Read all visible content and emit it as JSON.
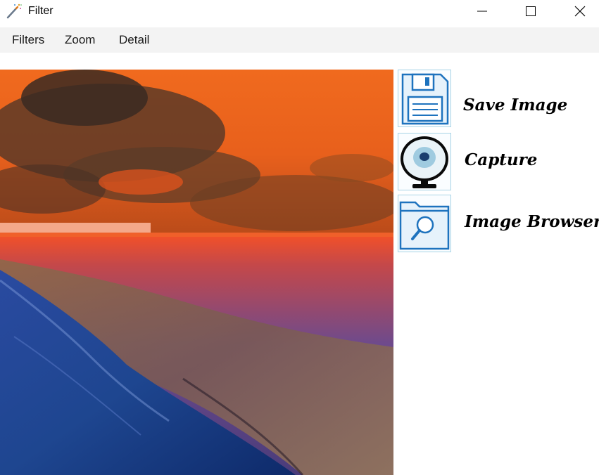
{
  "window": {
    "title": "Filter",
    "icon": "magic-wand-icon",
    "controls": [
      "minimize-icon",
      "maximize-icon",
      "close-icon"
    ]
  },
  "menu": {
    "items": [
      {
        "label": "Filters"
      },
      {
        "label": "Zoom"
      },
      {
        "label": "Detail"
      }
    ]
  },
  "canvas": {
    "description_icon": "photo-canvas"
  },
  "tools": [
    {
      "label": "Save Image",
      "icon": "floppy-disk-icon"
    },
    {
      "label": "Capture",
      "icon": "webcam-icon"
    },
    {
      "label": "Image Browser",
      "icon": "folder-search-icon"
    }
  ],
  "colors": {
    "menubar_bg": "#f3f3f3",
    "tool_border": "#a8d4e6",
    "icon_blue": "#1e73be"
  }
}
